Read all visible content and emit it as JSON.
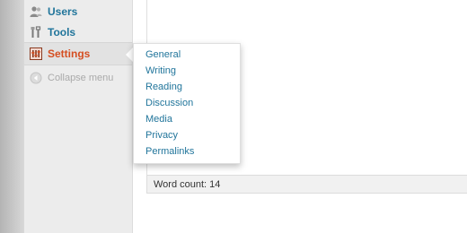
{
  "sidebar": {
    "items": [
      {
        "label": "Users",
        "icon": "users-icon"
      },
      {
        "label": "Tools",
        "icon": "tools-icon"
      },
      {
        "label": "Settings",
        "icon": "settings-icon",
        "current": true
      }
    ],
    "collapse_label": "Collapse menu"
  },
  "submenu": {
    "items": [
      "General",
      "Writing",
      "Reading",
      "Discussion",
      "Media",
      "Privacy",
      "Permalinks"
    ]
  },
  "status": {
    "word_count": "Word count: 14"
  },
  "colors": {
    "link": "#21759b",
    "current": "#d54e21",
    "sidebar_bg": "#ececec",
    "muted": "#aaaaaa"
  }
}
